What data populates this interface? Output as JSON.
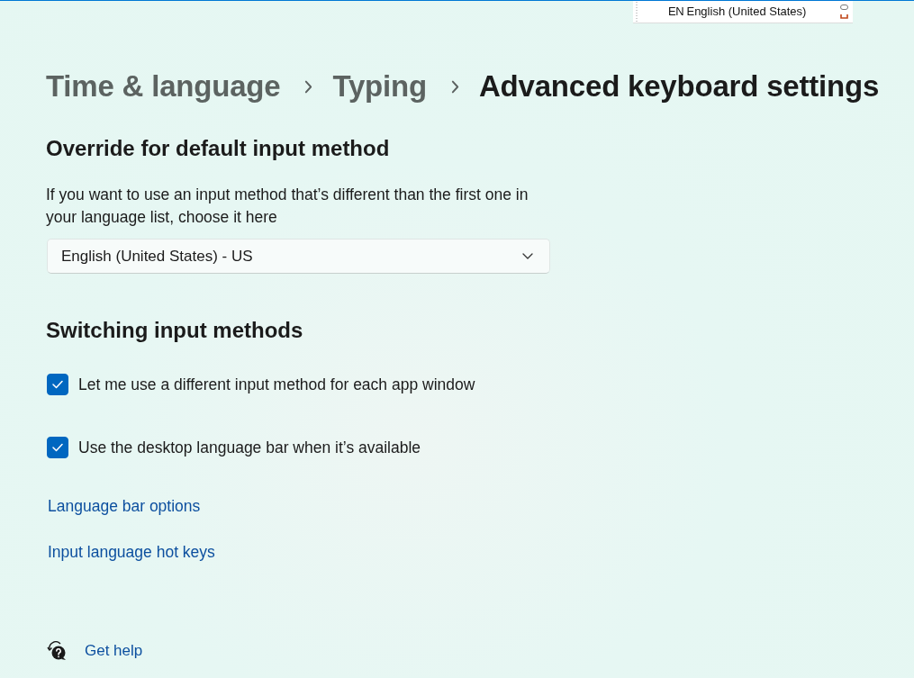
{
  "language_bar": {
    "code": "EN",
    "language": "English (United States)"
  },
  "breadcrumb": [
    {
      "label": "Time & language",
      "current": false
    },
    {
      "label": "Typing",
      "current": false
    },
    {
      "label": "Advanced keyboard settings",
      "current": true
    }
  ],
  "override": {
    "heading": "Override for default input method",
    "description": "If you want to use an input method that’s different than the first one in your language list, choose it here",
    "dropdown": {
      "value": "English (United States) - US"
    }
  },
  "switching": {
    "heading": "Switching input methods",
    "checkboxes": [
      {
        "label": "Let me use a different input method for each app window",
        "checked": true
      },
      {
        "label": "Use the desktop language bar when it’s available",
        "checked": true
      }
    ],
    "links": [
      {
        "label": "Language bar options"
      },
      {
        "label": "Input language hot keys"
      }
    ]
  },
  "help": {
    "label": "Get help"
  }
}
